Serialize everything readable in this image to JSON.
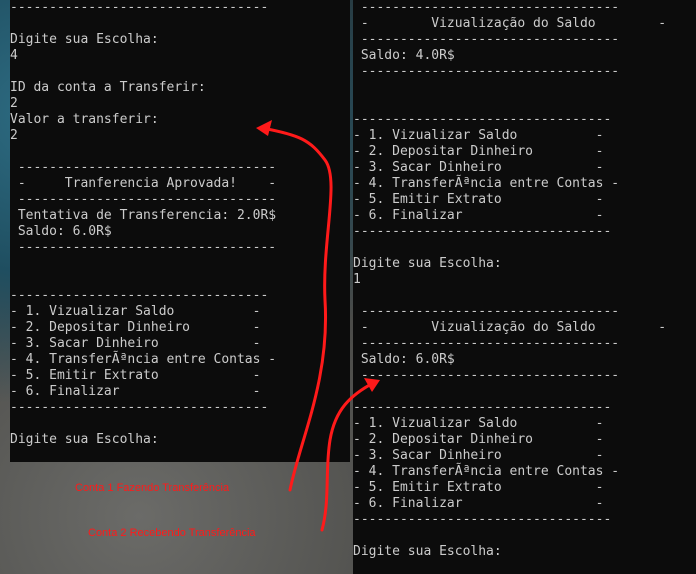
{
  "left_terminal": {
    "lines": [
      "---------------------------------",
      "",
      "Digite sua Escolha:",
      "4",
      "",
      "ID da conta a Transferir:",
      "2",
      "Valor a transferir:",
      "2",
      "",
      " ---------------------------------",
      " -     Tranferencia Aprovada!    -",
      " ---------------------------------",
      " Tentativa de Transferencia: 2.0R$",
      " Saldo: 6.0R$",
      " ---------------------------------",
      "",
      "",
      "---------------------------------",
      "- 1. Vizualizar Saldo          -",
      "- 2. Depositar Dinheiro        -",
      "- 3. Sacar Dinheiro            -",
      "- 4. TransferÃªncia entre Contas -",
      "- 5. Emitir Extrato            -",
      "- 6. Finalizar                 -",
      "---------------------------------",
      "",
      "Digite sua Escolha:"
    ]
  },
  "right_terminal": {
    "lines": [
      " ---------------------------------",
      " -        Vizualização do Saldo        -",
      " ---------------------------------",
      " Saldo: 4.0R$",
      " ---------------------------------",
      "",
      "",
      "---------------------------------",
      "- 1. Vizualizar Saldo          -",
      "- 2. Depositar Dinheiro        -",
      "- 3. Sacar Dinheiro            -",
      "- 4. TransferÃªncia entre Contas -",
      "- 5. Emitir Extrato            -",
      "- 6. Finalizar                 -",
      "---------------------------------",
      "",
      "Digite sua Escolha:",
      "1",
      "",
      " ---------------------------------",
      " -        Vizualização do Saldo        -",
      " ---------------------------------",
      " Saldo: 6.0R$",
      " ---------------------------------",
      "",
      "---------------------------------",
      "- 1. Vizualizar Saldo          -",
      "- 2. Depositar Dinheiro        -",
      "- 3. Sacar Dinheiro            -",
      "- 4. TransferÃªncia entre Contas -",
      "- 5. Emitir Extrato            -",
      "- 6. Finalizar                 -",
      "---------------------------------",
      "",
      "Digite sua Escolha:"
    ]
  },
  "annotations": {
    "caption_1": "Conta 1 Fazendo Transferência",
    "caption_2": "Conta 2 Recebendo Transferência",
    "color": "#ff1a1a"
  }
}
